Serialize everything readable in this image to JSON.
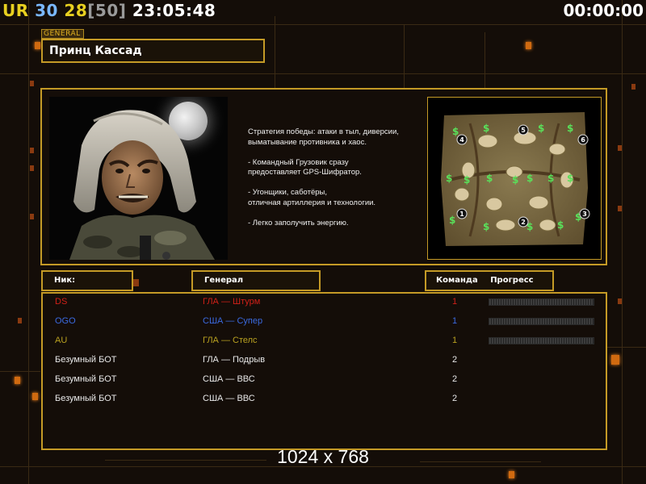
{
  "hud": {
    "ur": "UR",
    "count_a": "30",
    "count_b": "28",
    "count_c": "[50]",
    "clock": "23:05:48",
    "timer": "00:00:00"
  },
  "general": {
    "tag": "GENERAL",
    "name": "Принц Кассад"
  },
  "description": [
    "Стратегия победы: атаки в тыл, диверсии,\n выматывание противника и хаос.",
    "- Командный Грузовик сразу\nпредоставляет GPS-Шифратор.",
    "- Угонщики, саботёры,\nотличная артиллерия и технологии.",
    "- Легко заполучить энергию."
  ],
  "minimap": {
    "start_positions": [
      "1",
      "2",
      "3",
      "4",
      "5",
      "6"
    ],
    "money_icon": "$"
  },
  "table": {
    "headers": {
      "nick": "Ник:",
      "general": "Генерал",
      "team": "Команда",
      "progress": "Прогресс"
    },
    "rows": [
      {
        "nick": "DS",
        "general": "ГЛА — Штурм",
        "team": "1",
        "color": "#d02018",
        "progress": 0
      },
      {
        "nick": "OGO",
        "general": "США — Супер",
        "team": "1",
        "color": "#3a6ae0",
        "progress": 0
      },
      {
        "nick": "AU",
        "general": "ГЛА — Стелс",
        "team": "1",
        "color": "#b8a020",
        "progress": 0
      },
      {
        "nick": "Безумный БОТ",
        "general": "ГЛА — Подрыв",
        "team": "2",
        "color": "#e8e8e8",
        "progress": null
      },
      {
        "nick": "Безумный БОТ",
        "general": "США — ВВС",
        "team": "2",
        "color": "#e8e8e8",
        "progress": null
      },
      {
        "nick": "Безумный БОТ",
        "general": "США — ВВС",
        "team": "2",
        "color": "#e8e8e8",
        "progress": null
      }
    ]
  },
  "resolution": "1024 x 768",
  "colors": {
    "accent_gold": "#c49a26",
    "background": "#140d08",
    "glow_orange": "#d06a10"
  }
}
